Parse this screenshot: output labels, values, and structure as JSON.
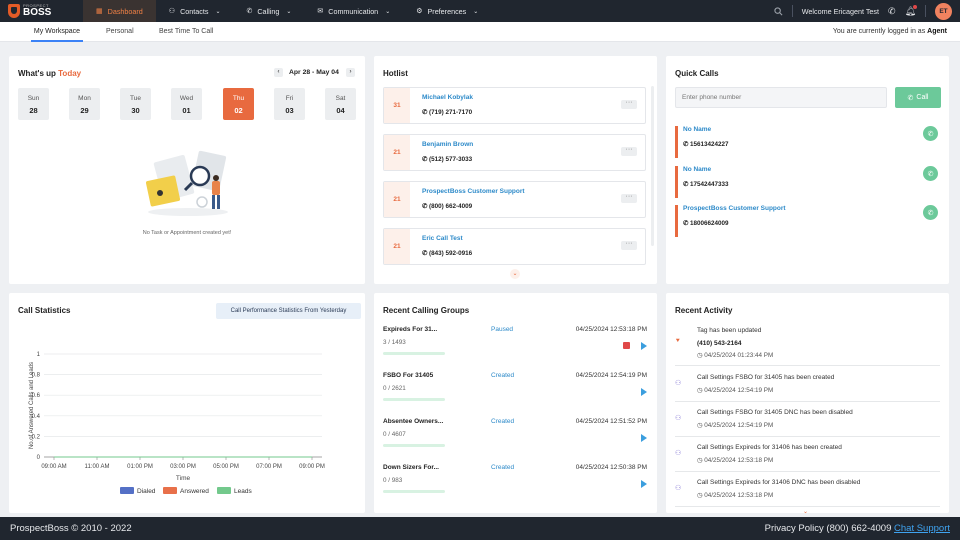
{
  "brand": {
    "small": "PROSPECT",
    "big": "BOSS"
  },
  "nav": [
    {
      "label": "Dashboard",
      "icon": "grid-icon"
    },
    {
      "label": "Contacts",
      "icon": "person-icon"
    },
    {
      "label": "Calling",
      "icon": "phone-icon"
    },
    {
      "label": "Communication",
      "icon": "mail-icon"
    },
    {
      "label": "Preferences",
      "icon": "settings-icon"
    }
  ],
  "welcome": "Welcome Ericagent Test",
  "avatar": "ET",
  "subtabs": [
    "My Workspace",
    "Personal",
    "Best Time To Call"
  ],
  "logged_in": {
    "prefix": "You are currently logged in as",
    "role": "Agent"
  },
  "whatsup": {
    "title": "What's up",
    "title_accent": "Today",
    "range": "Apr 28 - May 04",
    "days": [
      {
        "name": "Sun",
        "num": "28"
      },
      {
        "name": "Mon",
        "num": "29"
      },
      {
        "name": "Tue",
        "num": "30"
      },
      {
        "name": "Wed",
        "num": "01"
      },
      {
        "name": "Thu",
        "num": "02"
      },
      {
        "name": "Fri",
        "num": "03"
      },
      {
        "name": "Sat",
        "num": "04"
      }
    ],
    "empty": "No Task or Appointment created yet!"
  },
  "hotlist": {
    "title": "Hotlist",
    "items": [
      {
        "num": "31",
        "name": "Michael Kobylak",
        "phone": "(719) 271-7170"
      },
      {
        "num": "21",
        "name": "Benjamin Brown",
        "phone": "(512) 577-3033"
      },
      {
        "num": "21",
        "name": "ProspectBoss Customer Support",
        "phone": "(800) 662-4009"
      },
      {
        "num": "21",
        "name": "Eric Call Test",
        "phone": "(843) 592-0916"
      }
    ]
  },
  "quickcalls": {
    "title": "Quick Calls",
    "placeholder": "Enter phone number",
    "call_label": "Call",
    "items": [
      {
        "name": "No Name",
        "phone": "15613424227"
      },
      {
        "name": "No Name",
        "phone": "17542447333"
      },
      {
        "name": "ProspectBoss Customer Support",
        "phone": "18006624009"
      }
    ]
  },
  "callstats": {
    "title": "Call Statistics",
    "button": "Call Performance Statistics From Yesterday"
  },
  "chart_data": {
    "type": "line",
    "categories": [
      "09:00 AM",
      "11:00 AM",
      "01:00 PM",
      "03:00 PM",
      "05:00 PM",
      "07:00 PM",
      "09:00 PM"
    ],
    "ylim": [
      0,
      1
    ],
    "yticks": [
      "0",
      "0.2",
      "0.4",
      "0.6",
      "0.8",
      "1"
    ],
    "xlabel": "Time",
    "ylabel": "No.of Answered Calls and Leads",
    "legend": "bottom",
    "grid": true,
    "series": [
      {
        "name": "Dialed",
        "color": "#5470c6",
        "values": [
          0,
          0,
          0,
          0,
          0,
          0,
          0
        ]
      },
      {
        "name": "Answered",
        "color": "#e8704a",
        "values": [
          0,
          0,
          0,
          0,
          0,
          0,
          0
        ]
      },
      {
        "name": "Leads",
        "color": "#73c98c",
        "values": [
          0,
          0,
          0,
          0,
          0,
          0,
          0
        ]
      }
    ]
  },
  "groups": {
    "title": "Recent Calling Groups",
    "items": [
      {
        "name": "Expireds For 31...",
        "count": "3 / 1493",
        "status": "Paused",
        "date": "04/25/2024 12:53:18 PM",
        "stop": true
      },
      {
        "name": "FSBO For 31405",
        "count": "0 / 2621",
        "status": "Created",
        "date": "04/25/2024 12:54:19 PM",
        "stop": false
      },
      {
        "name": "Absentee Owners...",
        "count": "0 / 4607",
        "status": "Created",
        "date": "04/25/2024 12:51:52 PM",
        "stop": false
      },
      {
        "name": "Down Sizers For...",
        "count": "0 / 983",
        "status": "Created",
        "date": "04/25/2024 12:50:38 PM",
        "stop": false
      }
    ]
  },
  "activity": {
    "title": "Recent Activity",
    "items": [
      {
        "text": "Tag has been updated",
        "sub": "(410) 543-2164",
        "date": "04/25/2024 01:23:44 PM"
      },
      {
        "text": "Call Settings FSBO for 31405 has been created",
        "sub": "",
        "date": "04/25/2024 12:54:19 PM"
      },
      {
        "text": "Call Settings FSBO for 31405 DNC has been disabled",
        "sub": "",
        "date": "04/25/2024 12:54:19 PM"
      },
      {
        "text": "Call Settings Expireds for 31406 has been created",
        "sub": "",
        "date": "04/25/2024 12:53:18 PM"
      },
      {
        "text": "Call Settings Expireds for 31406 DNC has been disabled",
        "sub": "",
        "date": "04/25/2024 12:53:18 PM"
      }
    ]
  },
  "footer": {
    "copy": "ProspectBoss © 2010 - 2022",
    "links": "Privacy Policy (800) 662-4009",
    "chat": "Chat Support"
  }
}
